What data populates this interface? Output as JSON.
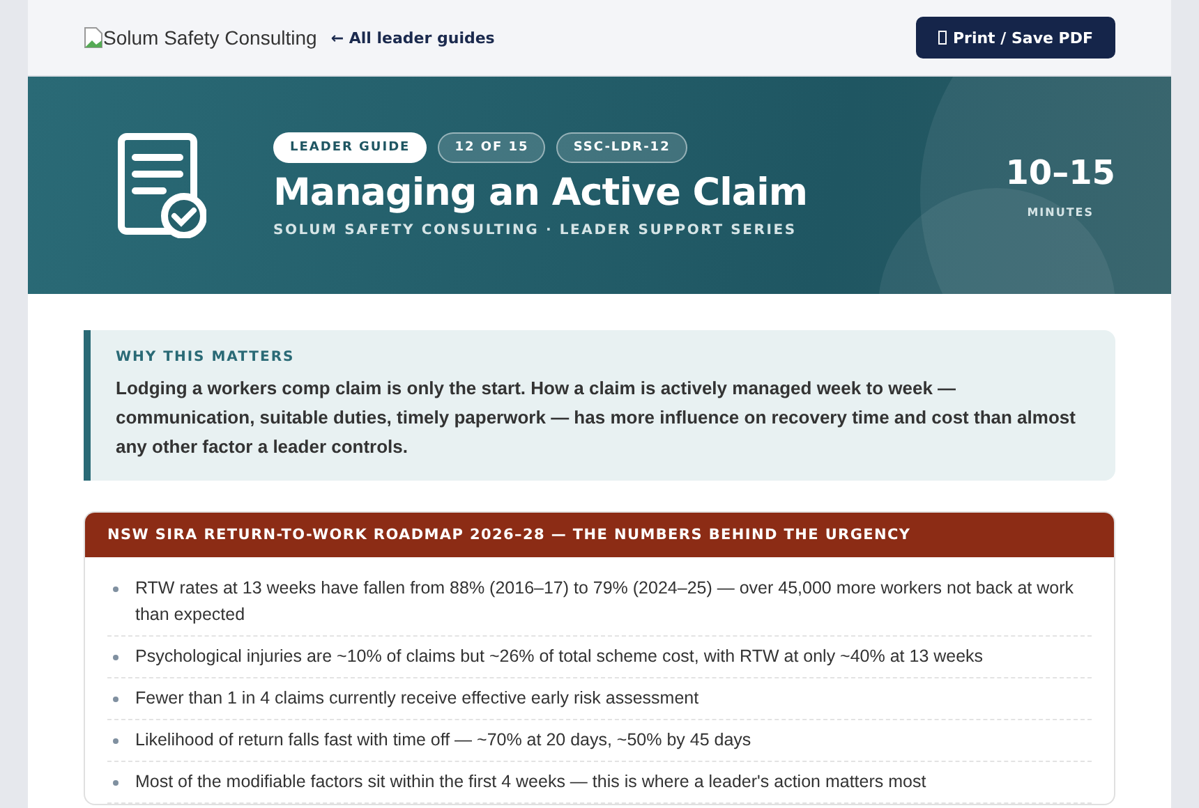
{
  "topbar": {
    "logo_alt": "Solum Safety Consulting",
    "back_link": "← All leader guides",
    "print_button": "Print / Save PDF"
  },
  "hero": {
    "badges": [
      {
        "label": "LEADER GUIDE",
        "kind": "primary"
      },
      {
        "label": "12 OF 15",
        "kind": "outline"
      },
      {
        "label": "SSC-LDR-12",
        "kind": "outline"
      }
    ],
    "title": "Managing an Active Claim",
    "subtitle": "SOLUM SAFETY CONSULTING · LEADER SUPPORT SERIES",
    "duration": "10–15",
    "duration_unit": "MINUTES"
  },
  "why": {
    "heading": "WHY THIS MATTERS",
    "text": "Lodging a workers comp claim is only the start. How a claim is actively managed week to week — communication, suitable duties, timely paperwork — has more influence on recovery time and cost than almost any other factor a leader controls."
  },
  "roadmap": {
    "heading": "NSW SIRA RETURN-TO-WORK ROADMAP 2026–28 — THE NUMBERS BEHIND THE URGENCY",
    "items": [
      "RTW rates at 13 weeks have fallen from 88% (2016–17) to 79% (2024–25) — over 45,000 more workers not back at work than expected",
      "Psychological injuries are ~10% of claims but ~26% of total scheme cost, with RTW at only ~40% at 13 weeks",
      "Fewer than 1 in 4 claims currently receive effective early risk assessment",
      "Likelihood of return falls fast with time off — ~70% at 20 days, ~50% by 45 days",
      "Most of the modifiable factors sit within the first 4 weeks — this is where a leader's action matters most"
    ]
  }
}
